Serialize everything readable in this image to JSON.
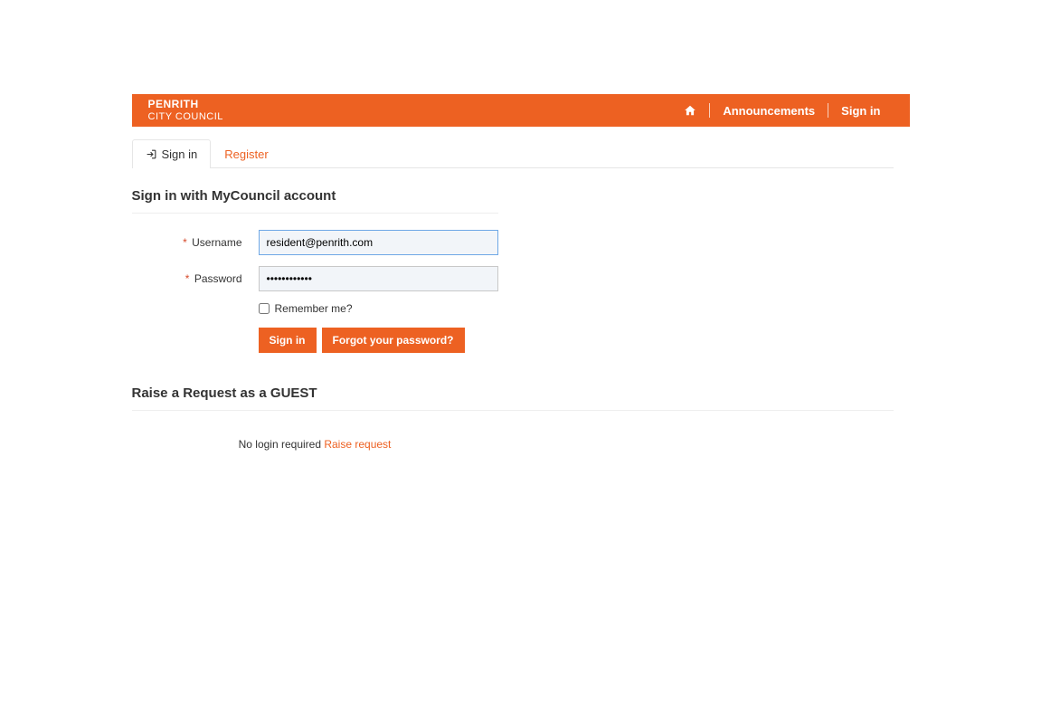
{
  "header": {
    "logo_top": "PENRITH",
    "logo_bottom": "CITY COUNCIL",
    "nav": {
      "announcements": "Announcements",
      "signin": "Sign in"
    }
  },
  "tabs": {
    "signin": "Sign in",
    "register": "Register"
  },
  "form": {
    "heading": "Sign in with MyCouncil account",
    "username_label": "Username",
    "username_value": "resident@penrith.com",
    "password_label": "Password",
    "password_value": "••••••••••••",
    "remember_label": "Remember me?",
    "signin_button": "Sign in",
    "forgot_button": "Forgot your password?"
  },
  "guest": {
    "heading": "Raise a Request as a GUEST",
    "prefix": "No login required ",
    "link": "Raise request"
  }
}
